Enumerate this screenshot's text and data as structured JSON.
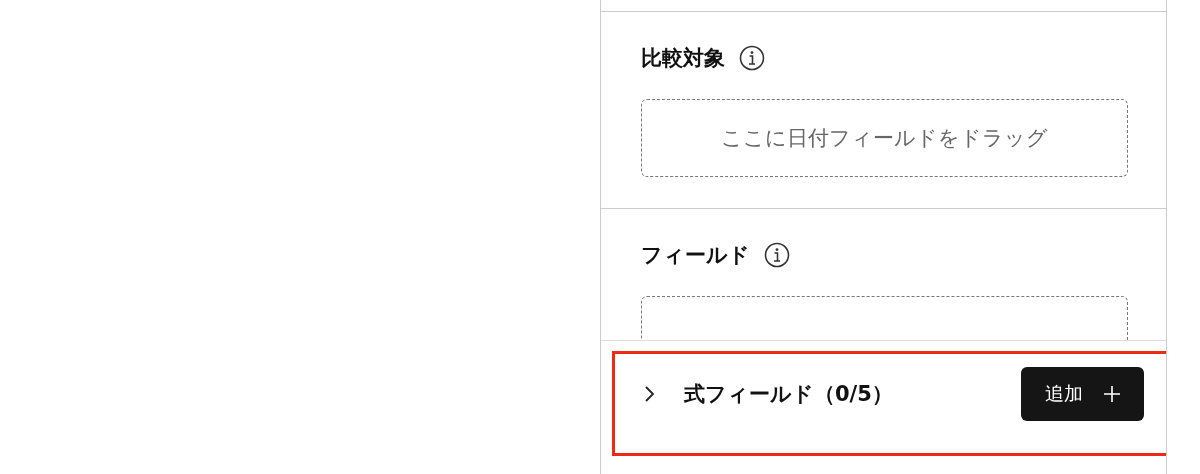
{
  "sections": [
    {
      "title": "比較対象",
      "placeholder": "ここに日付フィールドをドラッグ"
    },
    {
      "title": "フィールド"
    }
  ],
  "footer": {
    "title": "式フィールド（0/5）",
    "expanded": false,
    "highlighted": true,
    "button": "追加"
  }
}
